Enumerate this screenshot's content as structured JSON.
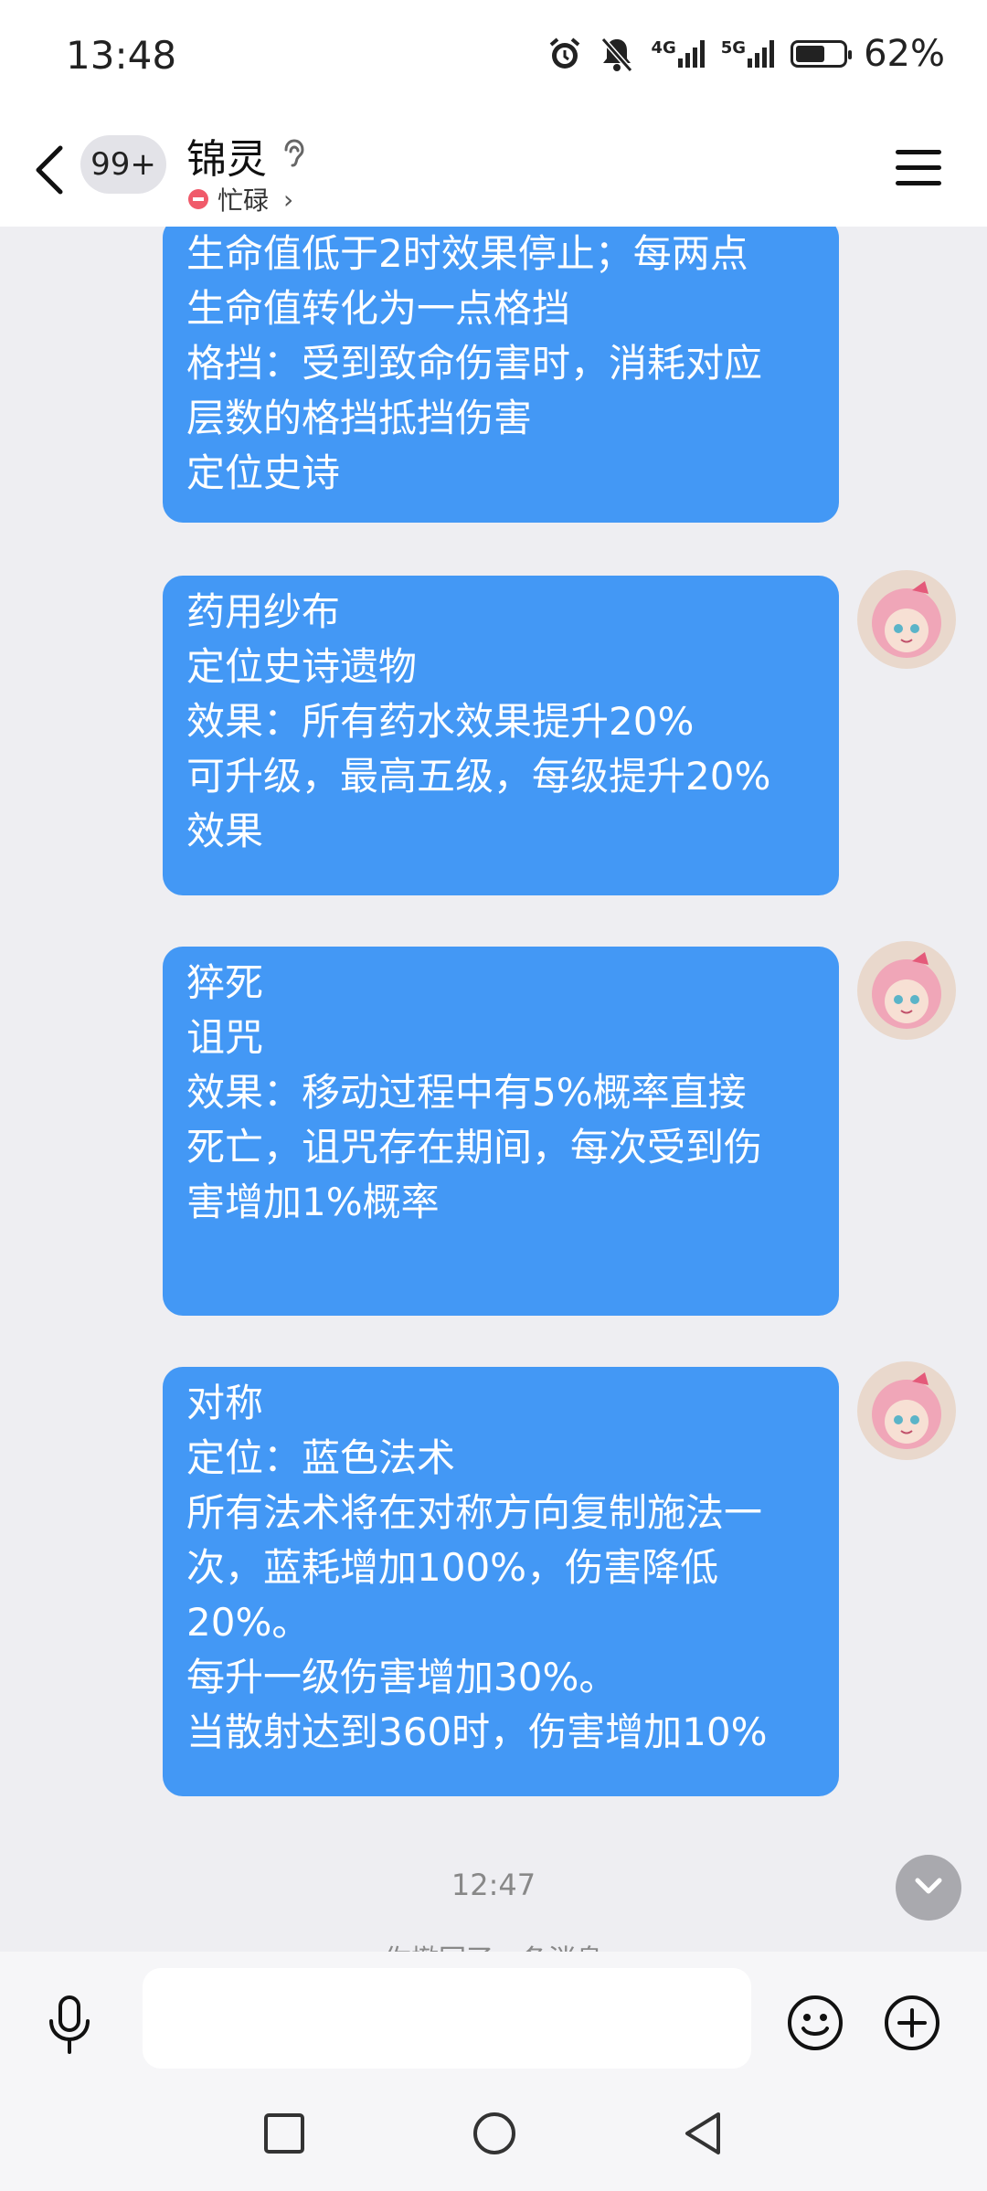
{
  "status_bar": {
    "time": "13:48",
    "net1": "4G",
    "net2": "5G",
    "battery": "62%",
    "battery_level": 0.62
  },
  "header": {
    "unread_badge": "99+",
    "contact_name": "锦灵",
    "status_text": "忙碌",
    "icons": [
      "back-icon",
      "ear-icon",
      "busy-status-icon",
      "chevron-right-icon",
      "menu-icon"
    ]
  },
  "messages": [
    {
      "lines": [
        "生命值低于2时效果停止；每两点",
        "生命值转化为一点格挡",
        "格挡：受到致命伤害时，消耗对应",
        "层数的格挡抵挡伤害",
        "定位史诗"
      ]
    },
    {
      "lines": [
        "药用纱布",
        "定位史诗遗物",
        "效果：所有药水效果提升20%",
        "可升级，最高五级，每级提升20%",
        "效果"
      ]
    },
    {
      "lines": [
        "猝死",
        "诅咒",
        "效果：移动过程中有5%概率直接",
        "死亡，诅咒存在期间，每次受到伤",
        "害增加1%概率"
      ]
    },
    {
      "lines": [
        "对称",
        "定位：蓝色法术",
        "所有法术将在对称方向复制施法一",
        "次，蓝耗增加100%，伤害降低",
        "20%。",
        "每升一级伤害增加30%。",
        "当散射达到360时，伤害增加10%"
      ]
    }
  ],
  "timestamp": "12:47",
  "recall_notice": "你撤回了一条消息",
  "input": {
    "placeholder": "",
    "icons": [
      "microphone-icon",
      "emoji-icon",
      "plus-icon"
    ]
  },
  "colors": {
    "bubble": "#4398f5",
    "background": "#eeeef2",
    "busy": "#f05a6a"
  }
}
